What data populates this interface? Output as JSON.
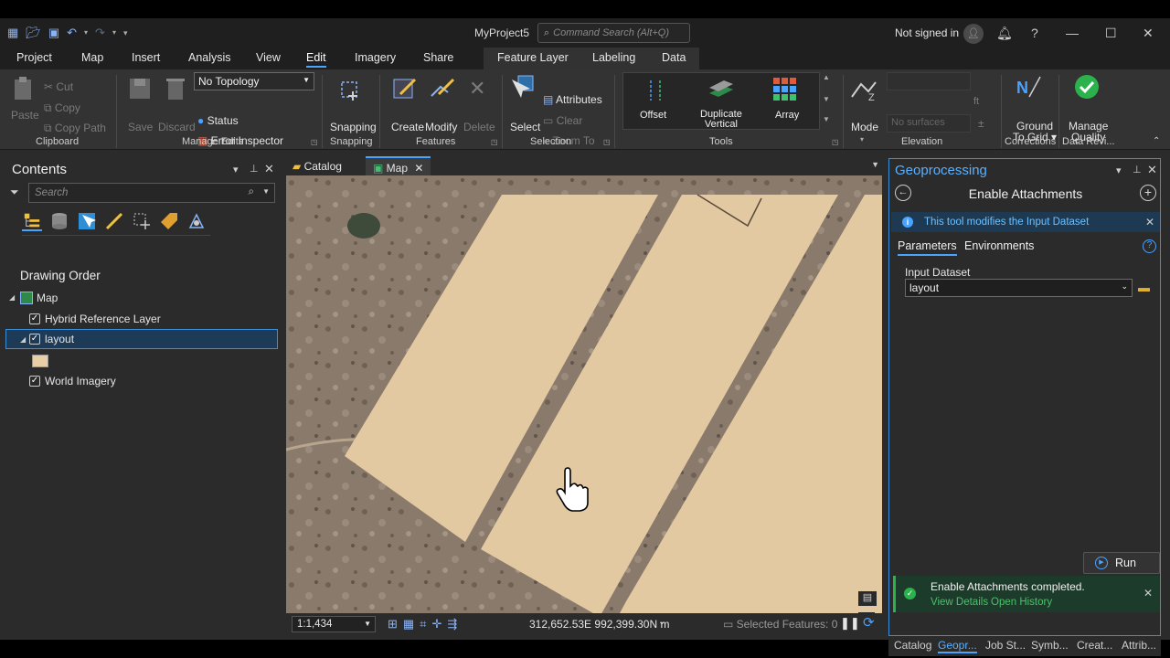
{
  "titlebar": {
    "project": "MyProject5",
    "command_search_placeholder": "Command Search (Alt+Q)",
    "sign_in": "Not signed in"
  },
  "ribbon_tabs": [
    "Project",
    "Map",
    "Insert",
    "Analysis",
    "View",
    "Edit",
    "Imagery",
    "Share"
  ],
  "context_tabs": [
    "Feature Layer",
    "Labeling",
    "Data"
  ],
  "active_tab": "Edit",
  "ribbon": {
    "clipboard": {
      "paste": "Paste",
      "cut": "Cut",
      "copy": "Copy",
      "copy_path": "Copy Path",
      "label": "Clipboard"
    },
    "manage_edits": {
      "save": "Save",
      "discard": "Discard",
      "topology": "No Topology",
      "status": "Status",
      "error_inspector": "Error Inspector",
      "label": "Manage Edits"
    },
    "snapping": {
      "button": "Snapping",
      "label": "Snapping"
    },
    "features": {
      "create": "Create",
      "modify": "Modify",
      "delete": "Delete",
      "label": "Features"
    },
    "selection": {
      "select": "Select",
      "attributes": "Attributes",
      "clear": "Clear",
      "zoom_to": "Zoom To",
      "label": "Selection"
    },
    "tools": {
      "offset": "Offset",
      "duplicate_vertical_1": "Duplicate",
      "duplicate_vertical_2": "Vertical",
      "array": "Array",
      "label": "Tools"
    },
    "elevation": {
      "mode": "Mode",
      "unit": "ft",
      "surfaces": "No surfaces",
      "label": "Elevation"
    },
    "corrections": {
      "ground_to_grid_1": "Ground",
      "ground_to_grid_2": "To Grid",
      "label": "Corrections"
    },
    "data_reviewer": {
      "manage_quality_1": "Manage",
      "manage_quality_2": "Quality",
      "label": "Data Revi..."
    }
  },
  "contents": {
    "title": "Contents",
    "search_placeholder": "Search",
    "drawing_order": "Drawing Order",
    "map": "Map",
    "layers": [
      {
        "name": "Hybrid Reference Layer",
        "checked": true
      },
      {
        "name": "layout",
        "checked": true,
        "selected": true
      },
      {
        "name": "World Imagery",
        "checked": true
      }
    ],
    "layout_symbol_color": "#e8cfa6"
  },
  "views": {
    "tabs": [
      "Catalog",
      "Map"
    ],
    "active": "Map"
  },
  "map_status": {
    "scale": "1:1,434",
    "coordinates": "312,652.53E 992,399.30N m",
    "selected_features": "Selected Features: 0"
  },
  "geoprocessing": {
    "title": "Geoprocessing",
    "tool": "Enable Attachments",
    "info": "This tool modifies the Input Dataset",
    "tabs": [
      "Parameters",
      "Environments"
    ],
    "param_label": "Input Dataset",
    "param_value": "layout",
    "run": "Run",
    "result_message": "Enable Attachments completed.",
    "view_details": "View Details",
    "open_history": "Open History"
  },
  "bottom_tabs": [
    "Catalog",
    "Geopr...",
    "Job St...",
    "Symb...",
    "Creat...",
    "Attrib..."
  ],
  "colors": {
    "accent": "#4aa3ff",
    "success": "#2bb24c",
    "polygon_fill": "#e3c9a1"
  }
}
